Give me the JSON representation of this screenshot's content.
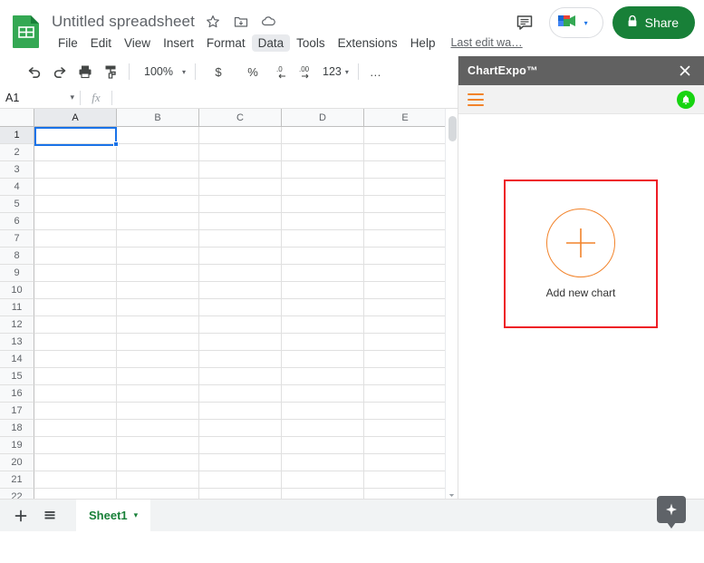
{
  "app": {
    "doc_title": "Untitled spreadsheet",
    "logo_icon": "google-sheets-logo",
    "star_icon": "star-icon",
    "move_icon": "move-to-folder-icon",
    "cloud_icon": "cloud-saved-icon"
  },
  "menubar": {
    "items": [
      {
        "label": "File",
        "active": false
      },
      {
        "label": "Edit",
        "active": false
      },
      {
        "label": "View",
        "active": false
      },
      {
        "label": "Insert",
        "active": false
      },
      {
        "label": "Format",
        "active": false
      },
      {
        "label": "Data",
        "active": true
      },
      {
        "label": "Tools",
        "active": false
      },
      {
        "label": "Extensions",
        "active": false
      },
      {
        "label": "Help",
        "active": false
      }
    ],
    "last_edit": "Last edit wa…"
  },
  "header_right": {
    "comment_icon": "comment-icon",
    "meet_icon": "google-meet-icon",
    "meet_caret": "▾",
    "share_label": "Share",
    "share_lock_icon": "lock-icon",
    "share_color": "#188038"
  },
  "toolbar": {
    "undo_icon": "undo-icon",
    "redo_icon": "redo-icon",
    "print_icon": "print-icon",
    "paint_icon": "paint-format-icon",
    "zoom_value": "100%",
    "zoom_caret": "▾",
    "currency_label": "$",
    "percent_label": "%",
    "decrease_decimal_label": ".0",
    "increase_decimal_label": ".00",
    "number_format_label": "123",
    "number_format_caret": "▾",
    "more_label": "…",
    "collapse_icon": "chevron-up-icon"
  },
  "formula_bar": {
    "name_box_value": "A1",
    "name_box_caret": "▾",
    "fx_label": "fx",
    "formula_value": ""
  },
  "grid": {
    "columns": [
      "A",
      "B",
      "C",
      "D",
      "E"
    ],
    "rows": [
      1,
      2,
      3,
      4,
      5,
      6,
      7,
      8,
      9,
      10,
      11,
      12,
      13,
      14,
      15,
      16,
      17,
      18,
      19,
      20,
      21,
      22
    ],
    "selected_cell": "A1",
    "selection_color": "#1a73e8"
  },
  "sheet_bar": {
    "add_sheet_icon": "plus-icon",
    "all_sheets_icon": "all-sheets-icon",
    "tabs": [
      {
        "label": "Sheet1",
        "caret": "▾",
        "active": true
      }
    ],
    "explore_icon": "explore-sparkle-icon"
  },
  "panel": {
    "title": "ChartExpo™",
    "close_icon": "close-icon",
    "menu_icon": "hamburger-menu-icon",
    "notification_icon": "bell-icon",
    "accent_color": "#f2832a",
    "highlight_color": "#ee1c25",
    "add_chart": {
      "label": "Add new chart",
      "plus_icon": "plus-icon"
    }
  }
}
